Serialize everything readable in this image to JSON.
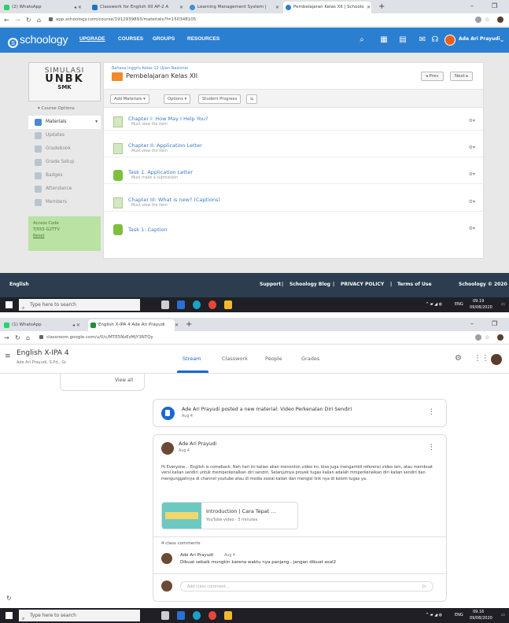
{
  "colors": {
    "schoology_blue": "#2b7fd1",
    "schoology_footer": "#2b3d4f",
    "classroom_blue": "#1967d2",
    "taskbar": "#1f1f25"
  },
  "shot1": {
    "tabs": [
      {
        "label": "(2) WhatsApp",
        "icon": "whatsapp-icon"
      },
      {
        "label": "Classwork for English XII AP-2 A",
        "icon": "classroom-icon"
      },
      {
        "label": "Learning Management System |",
        "icon": "lms-icon"
      },
      {
        "label": "Pembelajaran Kelas XII | Schoolo",
        "icon": "schoology-icon"
      }
    ],
    "url": "app.schoology.com/course/1912939893/materials?f=150348105",
    "header": {
      "logo": "schoology",
      "nav": [
        "UPGRADE",
        "COURSES",
        "GROUPS",
        "RESOURCES"
      ],
      "user": "Ade Ari Prayudi"
    },
    "sidebar": {
      "cover": {
        "line1": "SIMULASI",
        "line2": "UNBK",
        "line3": "SMK"
      },
      "course_options": "Course Options",
      "items": [
        {
          "label": "Materials"
        },
        {
          "label": "Updates"
        },
        {
          "label": "Gradebook"
        },
        {
          "label": "Grade Setup"
        },
        {
          "label": "Badges"
        },
        {
          "label": "Attendance"
        },
        {
          "label": "Members"
        }
      ],
      "access": {
        "label": "Access Code",
        "code": "TJ555-G2TTV",
        "reset": "Reset"
      }
    },
    "main": {
      "breadcrumb": "Bahasa Inggris Kelas 12 Ujian Nasional",
      "title": "Pembelajaran Kelas XII",
      "prev": "◂ Prev",
      "next": "Next ▸",
      "toolbar": [
        "Add Materials ▾",
        "Options ▾",
        "Student Progress",
        "⇆"
      ],
      "items": [
        {
          "title": "Chapter I: How May I Help You?",
          "sub": "Must view the item",
          "type": "page"
        },
        {
          "title": "Chapter II: Application Letter",
          "sub": "Must view the item",
          "type": "page"
        },
        {
          "title": "Task 1. Application Letter",
          "sub": "Must make a submission",
          "type": "assignment"
        },
        {
          "title": "Chapter III: What is new? (Captions)",
          "sub": "Must view the item",
          "type": "page"
        },
        {
          "title": "Task 1: Caption",
          "sub": "",
          "type": "assignment"
        }
      ]
    },
    "footer": {
      "language": "English",
      "links": [
        "Support",
        "|",
        "Schoology Blog",
        "|",
        "PRIVACY POLICY",
        "|",
        "Terms of Use"
      ],
      "copyright": "Schoology © 2020"
    },
    "taskbar": {
      "search": "Type here to search",
      "lang": "ENG",
      "time": "09.19",
      "date": "09/08/2020"
    }
  },
  "shot2": {
    "tabs": [
      {
        "label": "(1) WhatsApp",
        "icon": "whatsapp-icon"
      },
      {
        "label": "English X-IPA 4 Ade Ari Prayudi",
        "icon": "classroom-icon"
      }
    ],
    "url": "classroom.google.com/u/0/c/MTE5NzEzMjY3NTQy",
    "header": {
      "class_name": "English X-IPA 4",
      "teacher": "Ade Ari Prayudi, S.Pd., Gr.",
      "tabs": [
        "Stream",
        "Classwork",
        "People",
        "Grades"
      ]
    },
    "left_card": {
      "view_all": "View all"
    },
    "material_post": {
      "text": "Ade Ari Prayudi posted a new material: Video Perkenalan Diri Sendiri",
      "date": "Aug 4"
    },
    "post": {
      "author": "Ade Ari Prayudi",
      "date": "Aug 4",
      "body": "Hi Everyone… English is comeback. Nah hari ini kalian akan menonton video ini, bisa juga mengambil referensi video lain, atau membuat versi kalian sendiri untuk memperkenalkan diri sendiri. Selanjutnya proyek tugas kalian adalah mmperkenalkan diri kalian sendiri dan mengunggahnya di channel youtube atau di media sosial kalian dan mengisi link nya di kolom tugas ya.",
      "attachment": {
        "title": "Introduction | Cara Tepat …",
        "sub": "YouTube video · 3 minutes"
      },
      "comments_count": "4 class comments",
      "comment": {
        "author": "Ade Ari Prayudi",
        "date": "Aug 4",
        "text": "Dibuat sebaik mungkin karena waktu nya panjang.. jangan dibuat asal2"
      },
      "comment_placeholder": "Add class comment…"
    },
    "taskbar": {
      "search": "Type here to search",
      "lang": "ENG",
      "time": "09.16",
      "date": "09/08/2020"
    }
  }
}
